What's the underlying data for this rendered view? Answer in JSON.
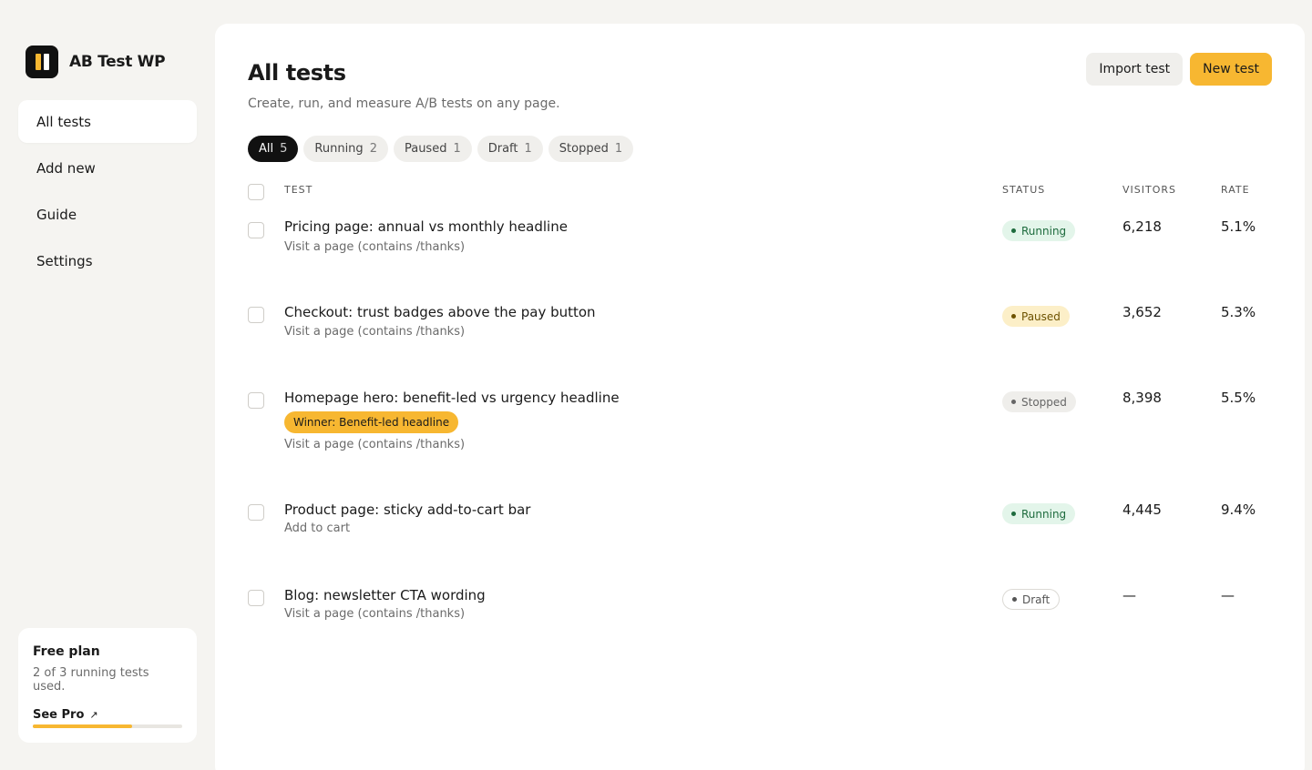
{
  "brand": {
    "name": "AB Test WP"
  },
  "nav": {
    "items": [
      {
        "label": "All tests",
        "active": true
      },
      {
        "label": "Add new"
      },
      {
        "label": "Guide"
      },
      {
        "label": "Settings"
      }
    ]
  },
  "plan": {
    "title": "Free plan",
    "desc": "2 of 3 running tests used.",
    "link": "See Pro",
    "link_icon": "arrow-up-right-icon",
    "usage_fraction": 0.667,
    "accent": "#f7b731"
  },
  "header": {
    "title": "All tests",
    "subtitle": "Create, run, and measure A/B tests on any page.",
    "import_label": "Import test",
    "new_label": "New test"
  },
  "filters": [
    {
      "label": "All",
      "count": "5",
      "active": true
    },
    {
      "label": "Running",
      "count": "2"
    },
    {
      "label": "Paused",
      "count": "1"
    },
    {
      "label": "Draft",
      "count": "1"
    },
    {
      "label": "Stopped",
      "count": "1"
    }
  ],
  "table": {
    "columns": {
      "test": "TEST",
      "status": "STATUS",
      "visitors": "VISITORS",
      "rate": "RATE"
    },
    "rows": [
      {
        "title": "Pricing page: annual vs monthly headline",
        "goal": "Visit a page (contains /thanks)",
        "status": "Running",
        "visitors": "6,218",
        "rate": "5.1%"
      },
      {
        "title": "Checkout: trust badges above the pay button",
        "goal": "Visit a page (contains /thanks)",
        "status": "Paused",
        "visitors": "3,652",
        "rate": "5.3%"
      },
      {
        "title": "Homepage hero: benefit-led vs urgency headline",
        "winner": "Winner: Benefit-led headline",
        "goal": "Visit a page (contains /thanks)",
        "status": "Stopped",
        "visitors": "8,398",
        "rate": "5.5%"
      },
      {
        "title": "Product page: sticky add-to-cart bar",
        "goal": "Add to cart",
        "status": "Running",
        "visitors": "4,445",
        "rate": "9.4%"
      },
      {
        "title": "Blog: newsletter CTA wording",
        "goal": "Visit a page (contains /thanks)",
        "status": "Draft",
        "visitors": "—",
        "rate": "—"
      }
    ]
  },
  "colors": {
    "accent": "#f7b731",
    "running": "#1d6b3d",
    "paused": "#6d5200",
    "stopped": "#666666"
  }
}
